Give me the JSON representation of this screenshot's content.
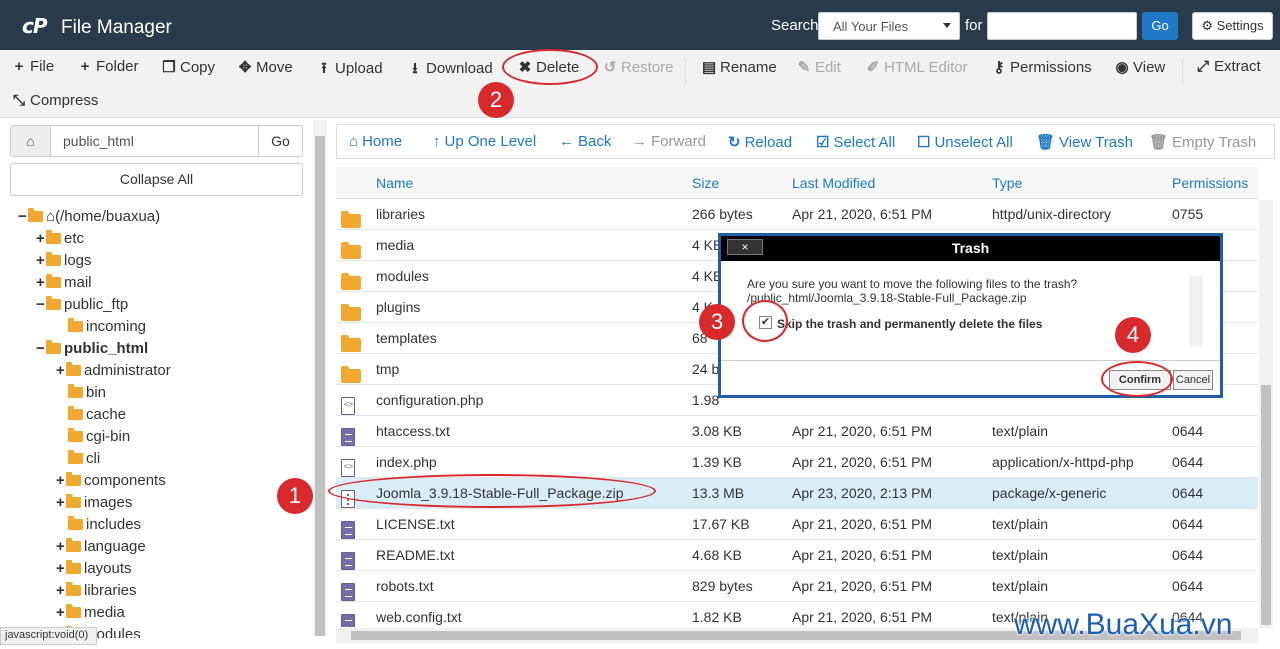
{
  "app": {
    "logo": "cP",
    "title": "File Manager"
  },
  "search": {
    "label": "Search",
    "scope": "All Your Files",
    "for_label": "for",
    "go": "Go",
    "settings": "Settings"
  },
  "toolbar": {
    "file": "File",
    "folder": "Folder",
    "copy": "Copy",
    "move": "Move",
    "upload": "Upload",
    "download": "Download",
    "delete": "Delete",
    "restore": "Restore",
    "rename": "Rename",
    "edit": "Edit",
    "html_editor": "HTML Editor",
    "permissions": "Permissions",
    "view": "View",
    "extract": "Extract",
    "compress": "Compress"
  },
  "left": {
    "path": "public_html",
    "go": "Go",
    "collapse": "Collapse All"
  },
  "tree": [
    "(/home/buaxua)",
    "etc",
    "logs",
    "mail",
    "public_ftp",
    "incoming",
    "public_html",
    "administrator",
    "bin",
    "cache",
    "cgi-bin",
    "cli",
    "components",
    "images",
    "includes",
    "language",
    "layouts",
    "libraries",
    "media",
    "modules"
  ],
  "status": "javascript:void(0)",
  "nav": {
    "home": "Home",
    "up": "Up One Level",
    "back": "Back",
    "forward": "Forward",
    "reload": "Reload",
    "select_all": "Select All",
    "unselect_all": "Unselect All",
    "view_trash": "View Trash",
    "empty_trash": "Empty Trash"
  },
  "columns": {
    "name": "Name",
    "size": "Size",
    "modified": "Last Modified",
    "type": "Type",
    "perms": "Permissions"
  },
  "files": [
    {
      "name": "libraries",
      "size": "266 bytes",
      "modified": "Apr 21, 2020, 6:51 PM",
      "type": "httpd/unix-directory",
      "perms": "0755"
    },
    {
      "name": "media",
      "size": "4 KB",
      "modified": "",
      "type": "",
      "perms": ""
    },
    {
      "name": "modules",
      "size": "4 KB",
      "modified": "",
      "type": "",
      "perms": ""
    },
    {
      "name": "plugins",
      "size": "4 K",
      "modified": "",
      "type": "",
      "perms": ""
    },
    {
      "name": "templates",
      "size": "68",
      "modified": "",
      "type": "",
      "perms": ""
    },
    {
      "name": "tmp",
      "size": "24 b",
      "modified": "",
      "type": "",
      "perms": ""
    },
    {
      "name": "configuration.php",
      "size": "1.98",
      "modified": "",
      "type": "",
      "perms": ""
    },
    {
      "name": "htaccess.txt",
      "size": "3.08 KB",
      "modified": "Apr 21, 2020, 6:51 PM",
      "type": "text/plain",
      "perms": "0644"
    },
    {
      "name": "index.php",
      "size": "1.39 KB",
      "modified": "Apr 21, 2020, 6:51 PM",
      "type": "application/x-httpd-php",
      "perms": "0644"
    },
    {
      "name": "Joomla_3.9.18-Stable-Full_Package.zip",
      "size": "13.3 MB",
      "modified": "Apr 23, 2020, 2:13 PM",
      "type": "package/x-generic",
      "perms": "0644"
    },
    {
      "name": "LICENSE.txt",
      "size": "17.67 KB",
      "modified": "Apr 21, 2020, 6:51 PM",
      "type": "text/plain",
      "perms": "0644"
    },
    {
      "name": "README.txt",
      "size": "4.68 KB",
      "modified": "Apr 21, 2020, 6:51 PM",
      "type": "text/plain",
      "perms": "0644"
    },
    {
      "name": "robots.txt",
      "size": "829 bytes",
      "modified": "Apr 21, 2020, 6:51 PM",
      "type": "text/plain",
      "perms": "0644"
    },
    {
      "name": "web.config.txt",
      "size": "1.82 KB",
      "modified": "Apr 21, 2020, 6:51 PM",
      "type": "text/plain",
      "perms": "0644"
    }
  ],
  "dialog": {
    "title": "Trash",
    "close": "×",
    "question": "Are you sure you want to move the following files to the trash?",
    "file": "/public_html/Joomla_3.9.18-Stable-Full_Package.zip",
    "skip_label": "Skip the trash and permanently delete the files",
    "skip_checked": "✔",
    "confirm": "Confirm",
    "cancel": "Cancel"
  },
  "steps": [
    "1",
    "2",
    "3",
    "4"
  ],
  "watermark": "www.BuaXua.vn",
  "colors": {
    "topbar": "#293a4a",
    "accent": "#1f79c5",
    "annotation": "#d8292d",
    "dialog_border": "#1e5fa8"
  }
}
